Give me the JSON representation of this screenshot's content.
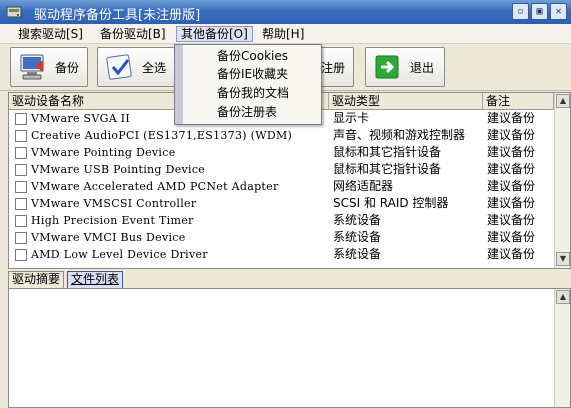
{
  "window": {
    "title": "驱动程序备份工具[未注册版]",
    "buttons": {
      "minimize": "▫",
      "restore": "▣",
      "close": "✕"
    }
  },
  "menu": [
    {
      "label": "搜索驱动[S]"
    },
    {
      "label": "备份驱动[B]"
    },
    {
      "label": "其他备份[O]"
    },
    {
      "label": "帮助[H]"
    }
  ],
  "toolbar": {
    "backup": "备份",
    "select_all": "全选",
    "register": "注册",
    "exit": "退出"
  },
  "dropdown": {
    "items": [
      "备份Cookies",
      "备份IE收藏夹",
      "备份我的文档",
      "备份注册表"
    ]
  },
  "table": {
    "headers": [
      "驱动设备名称",
      "驱动类型",
      "备注"
    ],
    "rows": [
      {
        "name": "VMware SVGA II",
        "type": "显示卡",
        "note": "建议备份"
      },
      {
        "name": "Creative AudioPCI (ES1371,ES1373) (WDM)",
        "type": "声音、视频和游戏控制器",
        "note": "建议备份"
      },
      {
        "name": "VMware Pointing Device",
        "type": "鼠标和其它指针设备",
        "note": "建议备份"
      },
      {
        "name": "VMware USB Pointing Device",
        "type": "鼠标和其它指针设备",
        "note": "建议备份"
      },
      {
        "name": "VMware Accelerated AMD PCNet Adapter",
        "type": "网络适配器",
        "note": "建议备份"
      },
      {
        "name": "VMware VMSCSI Controller",
        "type": "SCSI 和 RAID 控制器",
        "note": "建议备份"
      },
      {
        "name": "High Precision Event Timer",
        "type": "系统设备",
        "note": "建议备份"
      },
      {
        "name": "VMware VMCI Bus Device",
        "type": "系统设备",
        "note": "建议备份"
      },
      {
        "name": "AMD Low Level Device Driver",
        "type": "系统设备",
        "note": "建议备份"
      }
    ]
  },
  "tabs": [
    {
      "label": "驱动摘要",
      "selected": false
    },
    {
      "label": "文件列表",
      "selected": true
    }
  ],
  "icons": {
    "app": "disk-icon",
    "backup": "computer-backup-icon",
    "select_all": "checkmark-icon",
    "exit": "exit-arrow-icon"
  }
}
